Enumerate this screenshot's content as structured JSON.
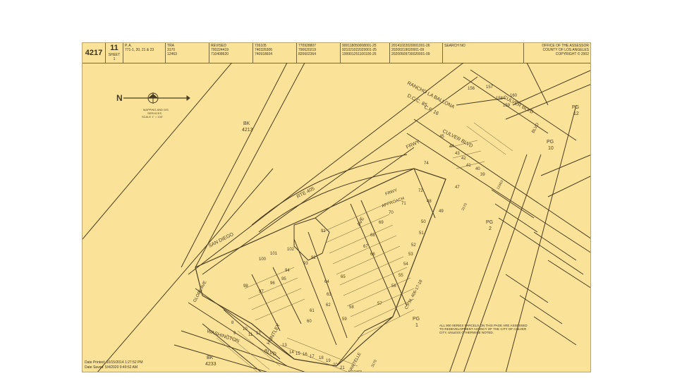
{
  "header": {
    "map_book": "4217",
    "page": "11",
    "sheet": "SHEET 1",
    "pa_label": "P. A.",
    "pa_value": "771-1, 20, 21 & 23",
    "tra_label": "TRA",
    "tra_values": [
      "3170",
      "12463"
    ],
    "revised_label": "REVISED",
    "revised_col1": [
      "700224419",
      "710408620"
    ],
    "revised_col2": [
      "726105",
      "740326306",
      "740918604"
    ],
    "revised_col3": [
      "770928807",
      "790620219",
      "820602364"
    ],
    "revised_col4": [
      "900118050008001-25",
      "921021022020001-25",
      "199901251100100-25"
    ],
    "revised_col5": [
      "20141022020001001-26",
      "20200219020001-09",
      "20200509730020001-09"
    ],
    "search_label": "SEARCH NO",
    "office": [
      "OFFICE OF THE ASSESSOR",
      "COUNTY OF LOS ANGELES",
      "COPYRIGHT © 2002"
    ]
  },
  "compass": {
    "label": "N",
    "caption": [
      "MAPPING AND GIS",
      "SERVICES",
      "SCALE 1\" = 100'"
    ]
  },
  "labels": {
    "bk_4213": [
      "BK",
      "4213"
    ],
    "bk_4233": [
      "BK",
      "4233"
    ],
    "rte_405": "RTE 405",
    "san_diego": "SAN DIEGO",
    "frwy_upper": "FRWY",
    "frwy_lower": "FRWY",
    "approach": "APPROACH",
    "rancho": "RANCHO LA BALLONA",
    "dcc": "D.C.C. 85",
    "cf": "C.F. 16",
    "culver_blvd_main": "CULVER BLVD",
    "culver_blvd_top": "CULVER BLVD",
    "blvd_right": "BLVD",
    "washington": "WASHINGTON",
    "blvd_bottom": "BLVD",
    "globe_ave": "GLOBE AVE",
    "huntley": "HUNTLEY",
    "sawtelle": "SAWTELLE",
    "ave": "AVE",
    "cpm": "C.P.M. 406-17-18",
    "pg_1": [
      "PG",
      "1"
    ],
    "pg_2": [
      "PG",
      "2"
    ],
    "pg_10": [
      "PG",
      "10"
    ],
    "pg_12": [
      "PG",
      "12"
    ],
    "tra_3170_a": "3170",
    "tra_12463_a": "12463",
    "tra_12463_b": "12463",
    "tra_3170_b": "3170"
  },
  "parcels": [
    "44",
    "43",
    "42",
    "41",
    "40",
    "39",
    "45",
    "47",
    "48",
    "49",
    "50",
    "51",
    "52",
    "53",
    "54",
    "55",
    "56",
    "57",
    "58",
    "59",
    "60",
    "61",
    "62",
    "63",
    "64",
    "65",
    "66",
    "67",
    "68",
    "69",
    "70",
    "71",
    "72",
    "74",
    "91",
    "92",
    "93",
    "94",
    "95",
    "96",
    "97",
    "98",
    "100",
    "101",
    "102",
    "8",
    "9",
    "10",
    "11",
    "12",
    "13",
    "14",
    "15",
    "16",
    "17",
    "18",
    "19",
    "20",
    "21",
    "156",
    "157",
    "158",
    "159",
    "160"
  ],
  "note": "ALL 900 SERIES PARCELS ON THIS PAGE ARE ASSESSED TO REDEVELOPMENT AGENCY OF THE CITY OF CULVER CITY, UNLESS OTHERWISE NOTED.",
  "footer": {
    "printed": "Date Printed: 10/15/2014 1:27:52 PM",
    "saved": "Date Saved: 5/4/2020 9:49:52 AM"
  }
}
